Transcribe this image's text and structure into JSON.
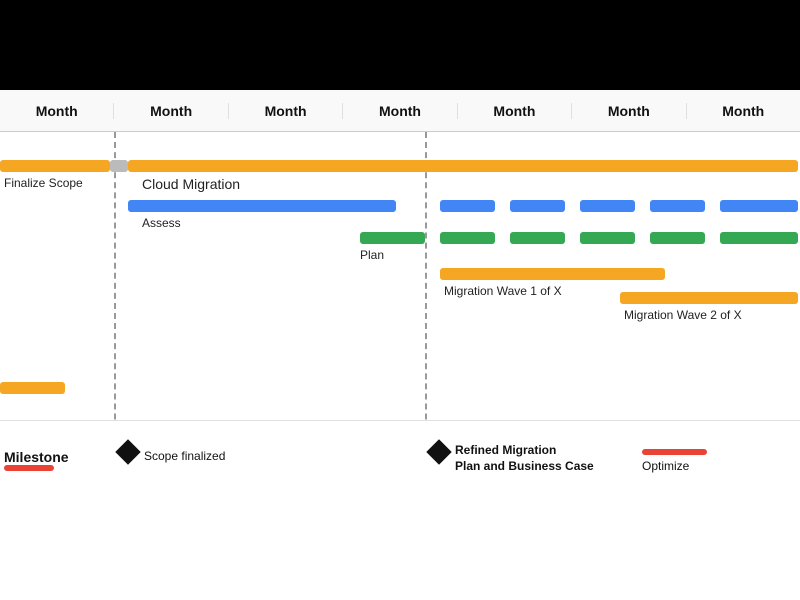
{
  "topBar": {},
  "months": [
    {
      "label": "Month"
    },
    {
      "label": "Month"
    },
    {
      "label": "Month"
    },
    {
      "label": "Month"
    },
    {
      "label": "Month"
    },
    {
      "label": "Month"
    },
    {
      "label": "Month"
    }
  ],
  "labels": {
    "finalizeScope": "Finalize Scope",
    "cloudMigration": "Cloud Migration",
    "assess": "Assess",
    "plan": "Plan",
    "migrationWave1": "Migration Wave 1 of X",
    "migrationWave2": "Migration Wave 2 of X",
    "milestone": "Milestone",
    "scopeFinalized": "Scope finalized",
    "refinedMigration": "Refined Migration",
    "planAndBusinessCase": "Plan and Business Case",
    "optimize": "Optimize"
  },
  "colors": {
    "orange": "#f5a623",
    "blue": "#4285f4",
    "green": "#34a853",
    "red": "#ea4335",
    "black": "#111111"
  }
}
